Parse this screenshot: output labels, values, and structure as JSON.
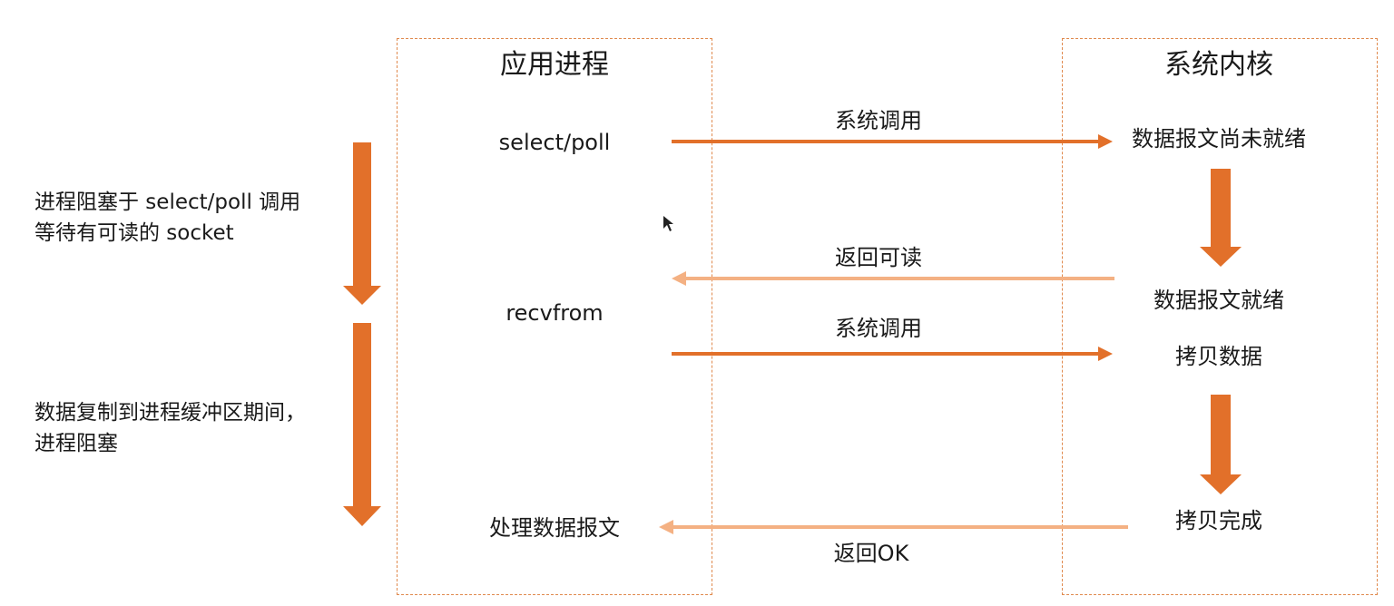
{
  "lanes": {
    "app_title": "应用进程",
    "kernel_title": "系统内核"
  },
  "app_steps": {
    "select_poll": "select/poll",
    "recvfrom": "recvfrom",
    "process": "处理数据报文"
  },
  "kernel_steps": {
    "not_ready": "数据报文尚未就绪",
    "ready": "数据报文就绪",
    "copy": "拷贝数据",
    "copy_done": "拷贝完成"
  },
  "messages": {
    "syscall_1": "系统调用",
    "return_readable": "返回可读",
    "syscall_2": "系统调用",
    "return_ok": "返回OK"
  },
  "notes": {
    "block_1_line1": "进程阻塞于 select/poll 调用",
    "block_1_line2": "等待有可读的 socket",
    "block_2_line1": "数据复制到进程缓冲区期间，",
    "block_2_line2": "进程阻塞"
  },
  "colors": {
    "arrow_dark": "#e2702a",
    "arrow_light": "#f4b183",
    "lane_border": "#e08a4e"
  }
}
